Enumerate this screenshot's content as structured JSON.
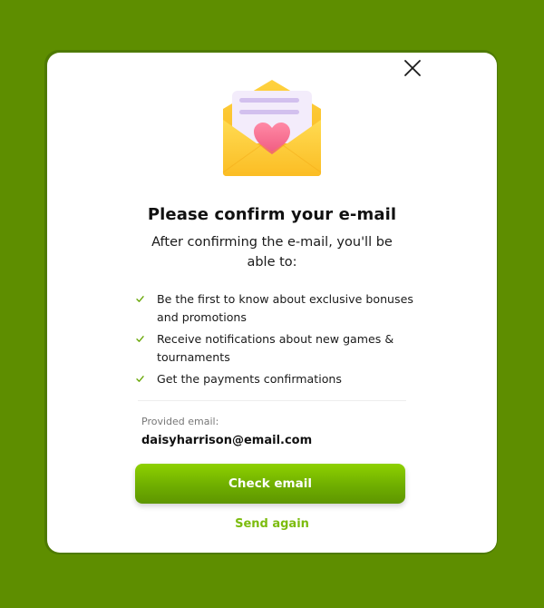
{
  "modal": {
    "title": "Please confirm your e-mail",
    "subtitle": "After confirming the e-mail, you'll be able to:",
    "benefits": [
      "Be the first to know about exclusive bonuses and promotions",
      "Receive notifications about new games & tournaments",
      "Get the payments confirmations"
    ],
    "email_label": "Provided email:",
    "email_value": "daisyharrison@email.com",
    "check_email_label": "Check email",
    "send_again_label": "Send again"
  },
  "icons": {
    "close": "close-icon",
    "illustration": "envelope-heart-icon",
    "check": "checkmark-icon"
  },
  "colors": {
    "page_background": "#5e8e00",
    "primary_button": "#76b800",
    "link": "#7cbc0e",
    "check": "#6aa80a"
  }
}
